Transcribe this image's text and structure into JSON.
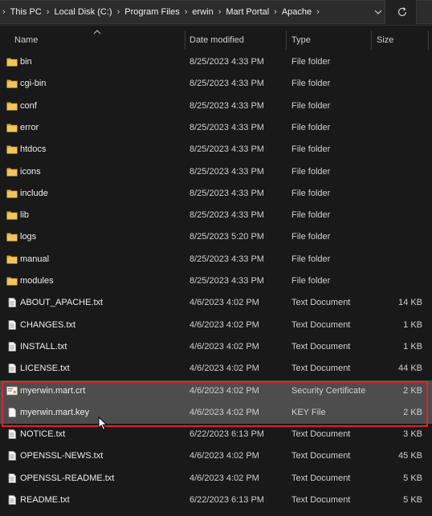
{
  "breadcrumbs": [
    "This PC",
    "Local Disk (C:)",
    "Program Files",
    "erwin",
    "Mart Portal",
    "Apache"
  ],
  "header": {
    "name": "Name",
    "date_modified": "Date modified",
    "type": "Type",
    "size": "Size"
  },
  "rows": [
    {
      "name": "bin",
      "date": "8/25/2023 4:33 PM",
      "type": "File folder",
      "size": "",
      "icon": "folder-icon"
    },
    {
      "name": "cgi-bin",
      "date": "8/25/2023 4:33 PM",
      "type": "File folder",
      "size": "",
      "icon": "folder-icon"
    },
    {
      "name": "conf",
      "date": "8/25/2023 4:33 PM",
      "type": "File folder",
      "size": "",
      "icon": "folder-icon"
    },
    {
      "name": "error",
      "date": "8/25/2023 4:33 PM",
      "type": "File folder",
      "size": "",
      "icon": "folder-icon"
    },
    {
      "name": "htdocs",
      "date": "8/25/2023 4:33 PM",
      "type": "File folder",
      "size": "",
      "icon": "folder-icon"
    },
    {
      "name": "icons",
      "date": "8/25/2023 4:33 PM",
      "type": "File folder",
      "size": "",
      "icon": "folder-icon"
    },
    {
      "name": "include",
      "date": "8/25/2023 4:33 PM",
      "type": "File folder",
      "size": "",
      "icon": "folder-icon"
    },
    {
      "name": "lib",
      "date": "8/25/2023 4:33 PM",
      "type": "File folder",
      "size": "",
      "icon": "folder-icon"
    },
    {
      "name": "logs",
      "date": "8/25/2023 5:20 PM",
      "type": "File folder",
      "size": "",
      "icon": "folder-icon"
    },
    {
      "name": "manual",
      "date": "8/25/2023 4:33 PM",
      "type": "File folder",
      "size": "",
      "icon": "folder-icon"
    },
    {
      "name": "modules",
      "date": "8/25/2023 4:33 PM",
      "type": "File folder",
      "size": "",
      "icon": "folder-icon"
    },
    {
      "name": "ABOUT_APACHE.txt",
      "date": "4/6/2023 4:02 PM",
      "type": "Text Document",
      "size": "14 KB",
      "icon": "text-file-icon"
    },
    {
      "name": "CHANGES.txt",
      "date": "4/6/2023 4:02 PM",
      "type": "Text Document",
      "size": "1 KB",
      "icon": "text-file-icon"
    },
    {
      "name": "INSTALL.txt",
      "date": "4/6/2023 4:02 PM",
      "type": "Text Document",
      "size": "1 KB",
      "icon": "text-file-icon"
    },
    {
      "name": "LICENSE.txt",
      "date": "4/6/2023 4:02 PM",
      "type": "Text Document",
      "size": "44 KB",
      "icon": "text-file-icon"
    },
    {
      "name": "myerwin.mart.crt",
      "date": "4/6/2023 4:02 PM",
      "type": "Security Certificate",
      "size": "2 KB",
      "icon": "certificate-icon",
      "selected": true
    },
    {
      "name": "myerwin.mart.key",
      "date": "4/6/2023 4:02 PM",
      "type": "KEY File",
      "size": "2 KB",
      "icon": "blank-file-icon",
      "selected": true
    },
    {
      "name": "NOTICE.txt",
      "date": "6/22/2023 6:13 PM",
      "type": "Text Document",
      "size": "3 KB",
      "icon": "text-file-icon"
    },
    {
      "name": "OPENSSL-NEWS.txt",
      "date": "4/6/2023 4:02 PM",
      "type": "Text Document",
      "size": "45 KB",
      "icon": "text-file-icon"
    },
    {
      "name": "OPENSSL-README.txt",
      "date": "4/6/2023 4:02 PM",
      "type": "Text Document",
      "size": "5 KB",
      "icon": "text-file-icon"
    },
    {
      "name": "README.txt",
      "date": "6/22/2023 6:13 PM",
      "type": "Text Document",
      "size": "5 KB",
      "icon": "text-file-icon"
    }
  ],
  "colors": {
    "background": "#191919",
    "folder": "#e8b84a",
    "selection": "#4d4d4d",
    "highlight_border": "#e0222a"
  }
}
